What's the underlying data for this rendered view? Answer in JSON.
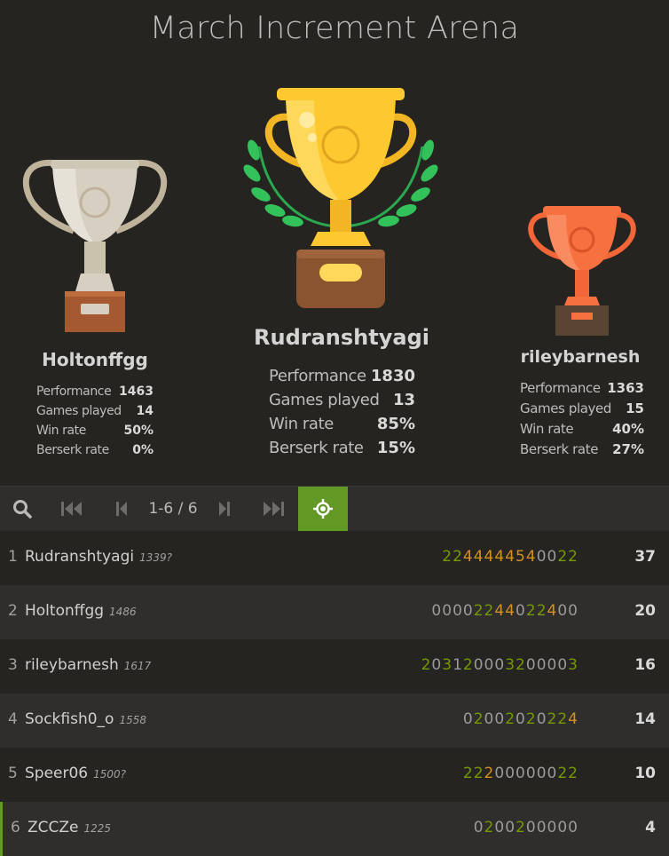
{
  "title": "March Increment Arena",
  "podium": {
    "first": {
      "name": "Rudranshtyagi",
      "stats": [
        {
          "label": "Performance",
          "value": "1830"
        },
        {
          "label": "Games played",
          "value": "13"
        },
        {
          "label": "Win rate",
          "value": "85%"
        },
        {
          "label": "Berserk rate",
          "value": "15%"
        }
      ]
    },
    "second": {
      "name": "Holtonffgg",
      "stats": [
        {
          "label": "Performance",
          "value": "1463"
        },
        {
          "label": "Games played",
          "value": "14"
        },
        {
          "label": "Win rate",
          "value": "50%"
        },
        {
          "label": "Berserk rate",
          "value": "0%"
        }
      ]
    },
    "third": {
      "name": "rileybarnesh",
      "stats": [
        {
          "label": "Performance",
          "value": "1363"
        },
        {
          "label": "Games played",
          "value": "15"
        },
        {
          "label": "Win rate",
          "value": "40%"
        },
        {
          "label": "Berserk rate",
          "value": "27%"
        }
      ]
    }
  },
  "pager": {
    "label": "1-6 / 6"
  },
  "icons": {
    "search": "search-icon",
    "first": "first-page-icon",
    "prev": "prev-page-icon",
    "next": "next-page-icon",
    "last": "last-page-icon",
    "focus": "crosshair-icon"
  },
  "colors": {
    "accent": "#629924",
    "streak_green": "#759900",
    "streak_orange": "#d59120",
    "gold": "#f7c12f",
    "silver": "#cfc6b4",
    "bronze": "#f36c3c"
  },
  "standings": [
    {
      "rank": "1",
      "name": "Rudranshtyagi",
      "rating": "1339?",
      "sheet": "2244444540022",
      "colors": "gooooooooggg g",
      "score": "37"
    },
    {
      "rank": "2",
      "name": "Holtonffgg",
      "rating": "1486",
      "sheet": "00002244022400",
      "score": "20"
    },
    {
      "rank": "3",
      "name": "rileybarnesh",
      "rating": "1617",
      "sheet": "203120003200003",
      "score": "16"
    },
    {
      "rank": "4",
      "name": "Sockfish0_o",
      "rating": "1558",
      "sheet": "02002020224",
      "score": "14"
    },
    {
      "rank": "5",
      "name": "Speer06",
      "rating": "1500?",
      "sheet": "22200000022",
      "score": "10"
    },
    {
      "rank": "6",
      "name": "ZCCZe",
      "rating": "1225",
      "sheet": "0200200000",
      "score": "4"
    }
  ]
}
